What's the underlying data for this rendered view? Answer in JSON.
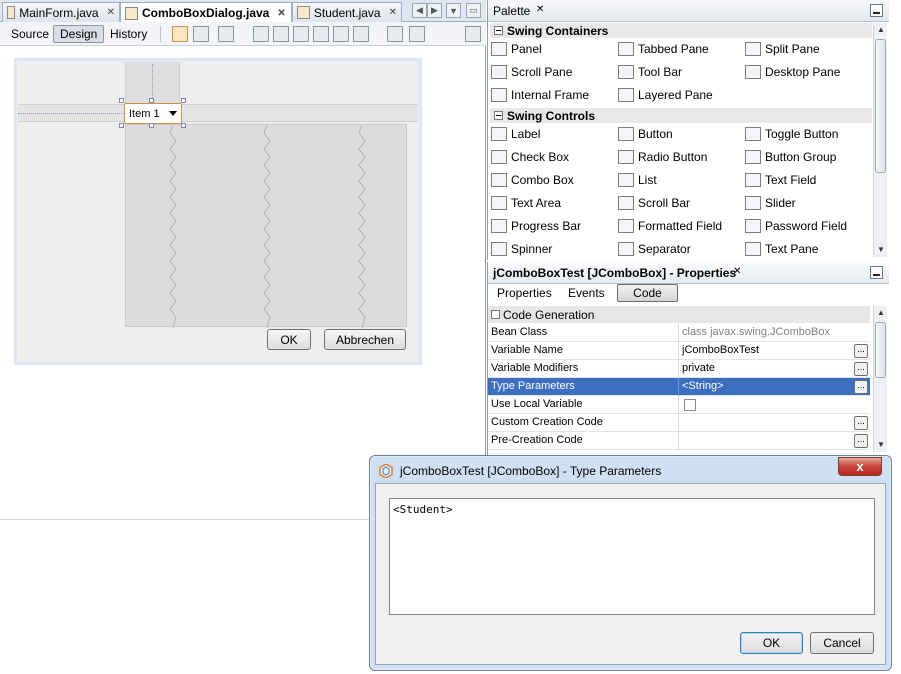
{
  "editor": {
    "tabs": [
      {
        "label": "MainForm.java",
        "active": false
      },
      {
        "label": "ComboBoxDialog.java",
        "active": true
      },
      {
        "label": "Student.java",
        "active": false
      }
    ],
    "modes": [
      "Source",
      "Design",
      "History"
    ],
    "active_mode": "Design",
    "form": {
      "combo_value": "Item 1",
      "ok_label": "OK",
      "cancel_label": "Abbrechen"
    }
  },
  "palette": {
    "title": "Palette",
    "categories": [
      {
        "label": "Swing Containers"
      },
      {
        "label": "Swing Controls"
      }
    ],
    "containers": [
      {
        "label": "Panel",
        "icon": "panel-icon"
      },
      {
        "label": "Tabbed Pane",
        "icon": "tabbed-pane-icon"
      },
      {
        "label": "Split Pane",
        "icon": "split-pane-icon"
      },
      {
        "label": "Scroll Pane",
        "icon": "scroll-pane-icon"
      },
      {
        "label": "Tool Bar",
        "icon": "tool-bar-icon"
      },
      {
        "label": "Desktop Pane",
        "icon": "desktop-pane-icon"
      },
      {
        "label": "Internal Frame",
        "icon": "internal-frame-icon"
      },
      {
        "label": "Layered Pane",
        "icon": "layered-pane-icon"
      }
    ],
    "controls": [
      {
        "label": "Label",
        "icon": "label-icon"
      },
      {
        "label": "Button",
        "icon": "button-icon"
      },
      {
        "label": "Toggle Button",
        "icon": "toggle-button-icon"
      },
      {
        "label": "Check Box",
        "icon": "check-box-icon"
      },
      {
        "label": "Radio Button",
        "icon": "radio-button-icon"
      },
      {
        "label": "Button Group",
        "icon": "button-group-icon"
      },
      {
        "label": "Combo Box",
        "icon": "combo-box-icon"
      },
      {
        "label": "List",
        "icon": "list-icon"
      },
      {
        "label": "Text Field",
        "icon": "text-field-icon"
      },
      {
        "label": "Text Area",
        "icon": "text-area-icon"
      },
      {
        "label": "Scroll Bar",
        "icon": "scroll-bar-icon"
      },
      {
        "label": "Slider",
        "icon": "slider-icon"
      },
      {
        "label": "Progress Bar",
        "icon": "progress-bar-icon"
      },
      {
        "label": "Formatted Field",
        "icon": "formatted-field-icon"
      },
      {
        "label": "Password Field",
        "icon": "password-field-icon"
      },
      {
        "label": "Spinner",
        "icon": "spinner-icon"
      },
      {
        "label": "Separator",
        "icon": "separator-icon"
      },
      {
        "label": "Text Pane",
        "icon": "text-pane-icon"
      }
    ]
  },
  "properties": {
    "title": "jComboBoxTest [JComboBox] - Properties",
    "tabs": [
      "Properties",
      "Events",
      "Code"
    ],
    "active_tab": "Code",
    "section": "Code Generation",
    "rows": [
      {
        "key": "Bean Class",
        "value": "class javax.swing.JComboBox"
      },
      {
        "key": "Variable Name",
        "value": "jComboBoxTest"
      },
      {
        "key": "Variable Modifiers",
        "value": "private"
      },
      {
        "key": "Type Parameters",
        "value": "<String>"
      },
      {
        "key": "Use Local Variable",
        "value": ""
      },
      {
        "key": "Custom Creation Code",
        "value": ""
      },
      {
        "key": "Pre-Creation Code",
        "value": ""
      }
    ],
    "selected_row": "Type Parameters"
  },
  "dialog": {
    "title": "jComboBoxTest [JComboBox] - Type Parameters",
    "text": "<Student>",
    "ok_label": "OK",
    "cancel_label": "Cancel",
    "close_glyph": "x"
  },
  "colors": {
    "selection": "#3c6fbf",
    "combo_border": "#d09045",
    "close_button": "#c7453a"
  }
}
